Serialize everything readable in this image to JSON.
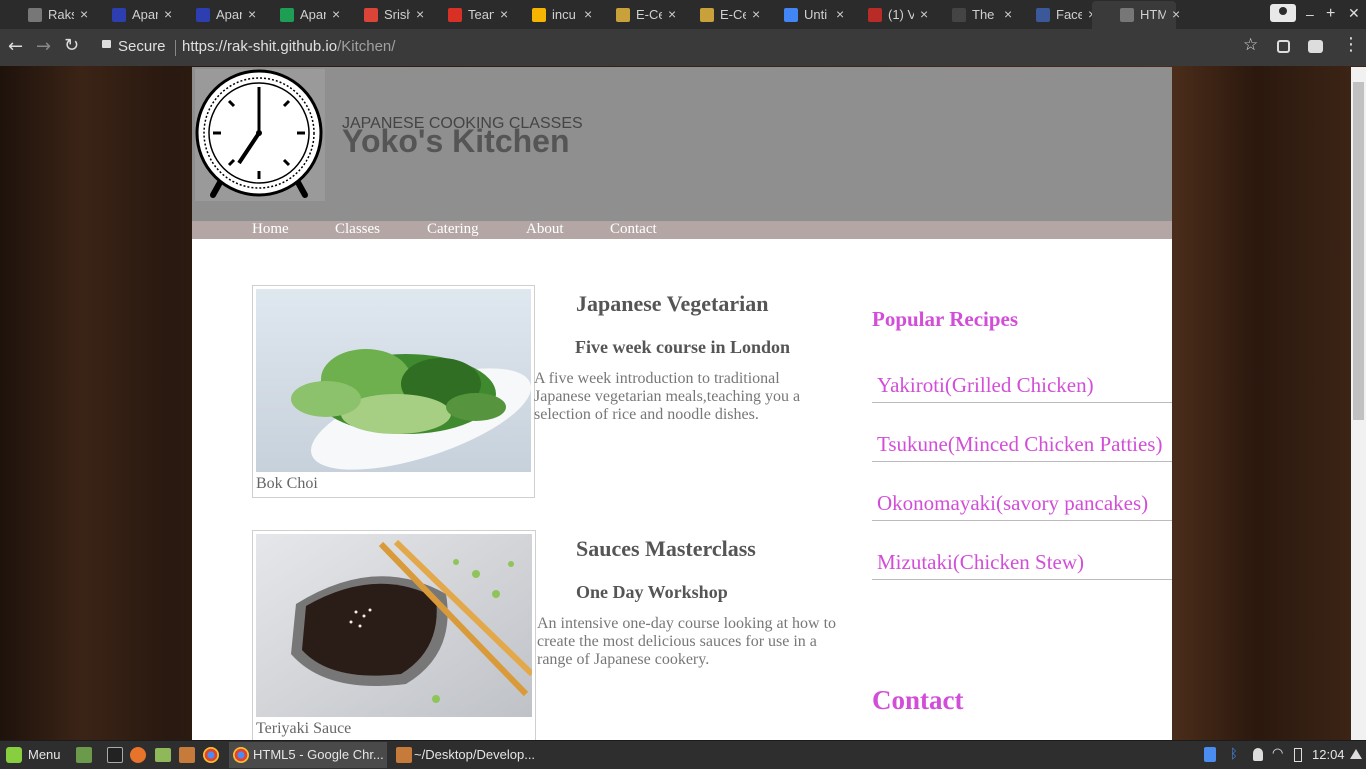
{
  "browser": {
    "tabs": [
      {
        "label": "Raks",
        "fav": "doc-icon"
      },
      {
        "label": "Apar",
        "fav": "apar-icon"
      },
      {
        "label": "Apar",
        "fav": "apar-icon"
      },
      {
        "label": "Apar",
        "fav": "sheets-icon"
      },
      {
        "label": "Srish",
        "fav": "google-plus-icon"
      },
      {
        "label": "Tean",
        "fav": "gmail-icon"
      },
      {
        "label": "incu",
        "fav": "slides-icon"
      },
      {
        "label": "E-Ce",
        "fav": "ecell-icon"
      },
      {
        "label": "E-Ce",
        "fav": "ecell-icon"
      },
      {
        "label": "Unti",
        "fav": "docs-icon"
      },
      {
        "label": "(1) V",
        "fav": "quora-icon"
      },
      {
        "label": "The",
        "fav": "dots-icon"
      },
      {
        "label": "Face",
        "fav": "facebook-icon"
      },
      {
        "label": "HTM",
        "fav": "doc-icon"
      }
    ],
    "secure_label": "Secure",
    "url_base": "https://rak-shit.github.io",
    "url_path": "/Kitchen/"
  },
  "site": {
    "tagline": "JAPANESE COOKING CLASSES",
    "title": "Yoko's Kitchen",
    "nav": [
      "Home",
      "Classes",
      "Catering",
      "About",
      "Contact"
    ]
  },
  "courses": [
    {
      "caption": "Bok Choi",
      "title": "Japanese Vegetarian",
      "subtitle": "Five week course in London",
      "description": "A five week introduction to traditional Japanese vegetarian meals,teaching you a selection of rice and noodle dishes."
    },
    {
      "caption": "Teriyaki Sauce",
      "title": "Sauces Masterclass",
      "subtitle": "One Day Workshop",
      "description": "An intensive one-day course looking at how to create the most delicious sauces for use in a range of Japanese cookery."
    }
  ],
  "sidebar": {
    "heading": "Popular Recipes",
    "recipes": [
      "Yakiroti(Grilled Chicken)",
      "Tsukune(Minced Chicken Patties)",
      "Okonomayaki(savory pancakes)",
      "Mizutaki(Chicken Stew)"
    ],
    "contact_heading": "Contact"
  },
  "taskbar": {
    "menu_label": "Menu",
    "windows": [
      "HTML5 - Google Chr...",
      "~/Desktop/Develop..."
    ],
    "clock": "12:04"
  },
  "colors": {
    "accent": "#d24ed8",
    "header_bg": "#8f8f8f",
    "nav_bg": "#b3a6a4"
  }
}
